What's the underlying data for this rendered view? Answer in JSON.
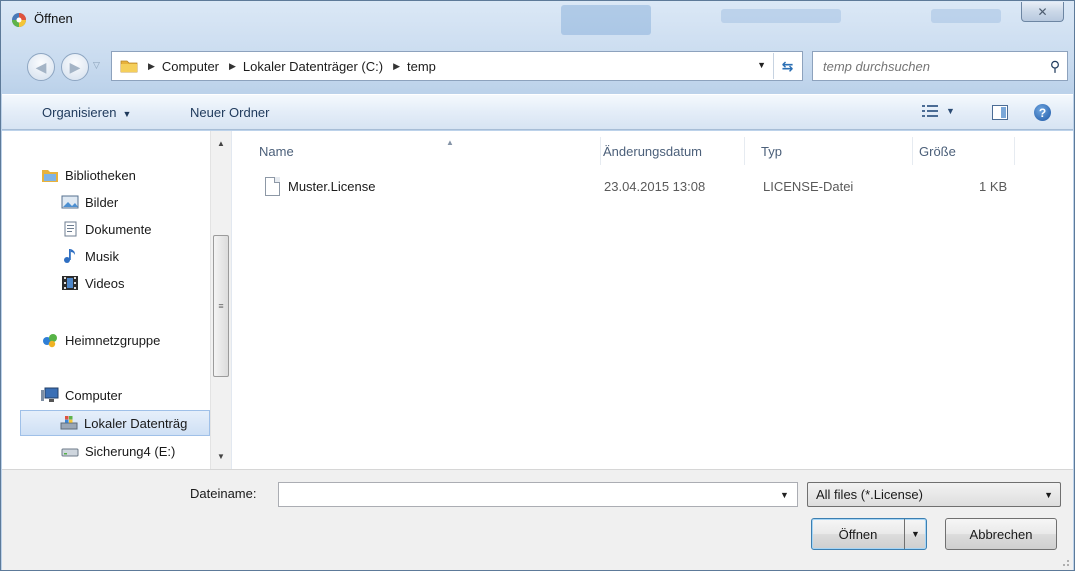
{
  "window": {
    "title": "Öffnen",
    "close_label": "✕"
  },
  "address": {
    "crumbs": [
      "Computer",
      "Lokaler Datenträger (C:)",
      "temp"
    ]
  },
  "search": {
    "placeholder": "temp durchsuchen"
  },
  "toolbar": {
    "organize_label": "Organisieren",
    "new_folder_label": "Neuer Ordner"
  },
  "sidebar": {
    "items": [
      {
        "label": "Bibliotheken",
        "icon": "libraries-icon"
      },
      {
        "label": "Bilder",
        "icon": "pictures-icon"
      },
      {
        "label": "Dokumente",
        "icon": "documents-icon"
      },
      {
        "label": "Musik",
        "icon": "music-icon"
      },
      {
        "label": "Videos",
        "icon": "videos-icon"
      },
      {
        "label": "Heimnetzgruppe",
        "icon": "homegroup-icon"
      },
      {
        "label": "Computer",
        "icon": "computer-icon"
      },
      {
        "label": "Lokaler Datenträg",
        "icon": "local-disk-icon",
        "selected": true
      },
      {
        "label": "Sicherung4 (E:)",
        "icon": "drive-icon"
      }
    ]
  },
  "filelist": {
    "columns": [
      "Name",
      "Änderungsdatum",
      "Typ",
      "Größe"
    ],
    "rows": [
      {
        "name": "Muster.License",
        "modified": "23.04.2015 13:08",
        "type": "LICENSE-Datei",
        "size": "1 KB"
      }
    ]
  },
  "bottom": {
    "filename_label": "Dateiname:",
    "filename_value": "",
    "filter_value": "All files (*.License)",
    "open_label": "Öffnen",
    "cancel_label": "Abbrechen"
  },
  "colors": {
    "accent": "#2b6fb4",
    "selection": "#cfe0f5",
    "chrome": "#c9dbef"
  }
}
